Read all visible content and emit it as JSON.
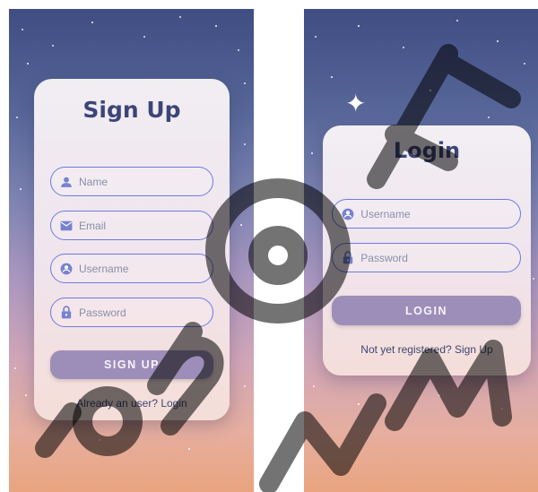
{
  "signup": {
    "title": "Sign Up",
    "fields": [
      {
        "icon": "person-icon",
        "placeholder": "Name"
      },
      {
        "icon": "email-icon",
        "placeholder": "Email"
      },
      {
        "icon": "account-circle-icon",
        "placeholder": "Username"
      },
      {
        "icon": "lock-icon",
        "placeholder": "Password"
      }
    ],
    "button_label": "SIGN UP",
    "link_text": "Already an user? Login"
  },
  "login": {
    "title": "Login",
    "fields": [
      {
        "icon": "account-circle-icon",
        "placeholder": "Username"
      },
      {
        "icon": "lock-icon",
        "placeholder": "Password"
      }
    ],
    "button_label": "LOGIN",
    "link_text": "Not yet registered? Sign Up"
  },
  "colors": {
    "title": "#3d4577",
    "field_border": "#6f79e0",
    "icon": "#7782cf",
    "button": "#9d8eb9",
    "sky_top": "#3f4d82",
    "sky_bottom": "#e9a47f"
  }
}
